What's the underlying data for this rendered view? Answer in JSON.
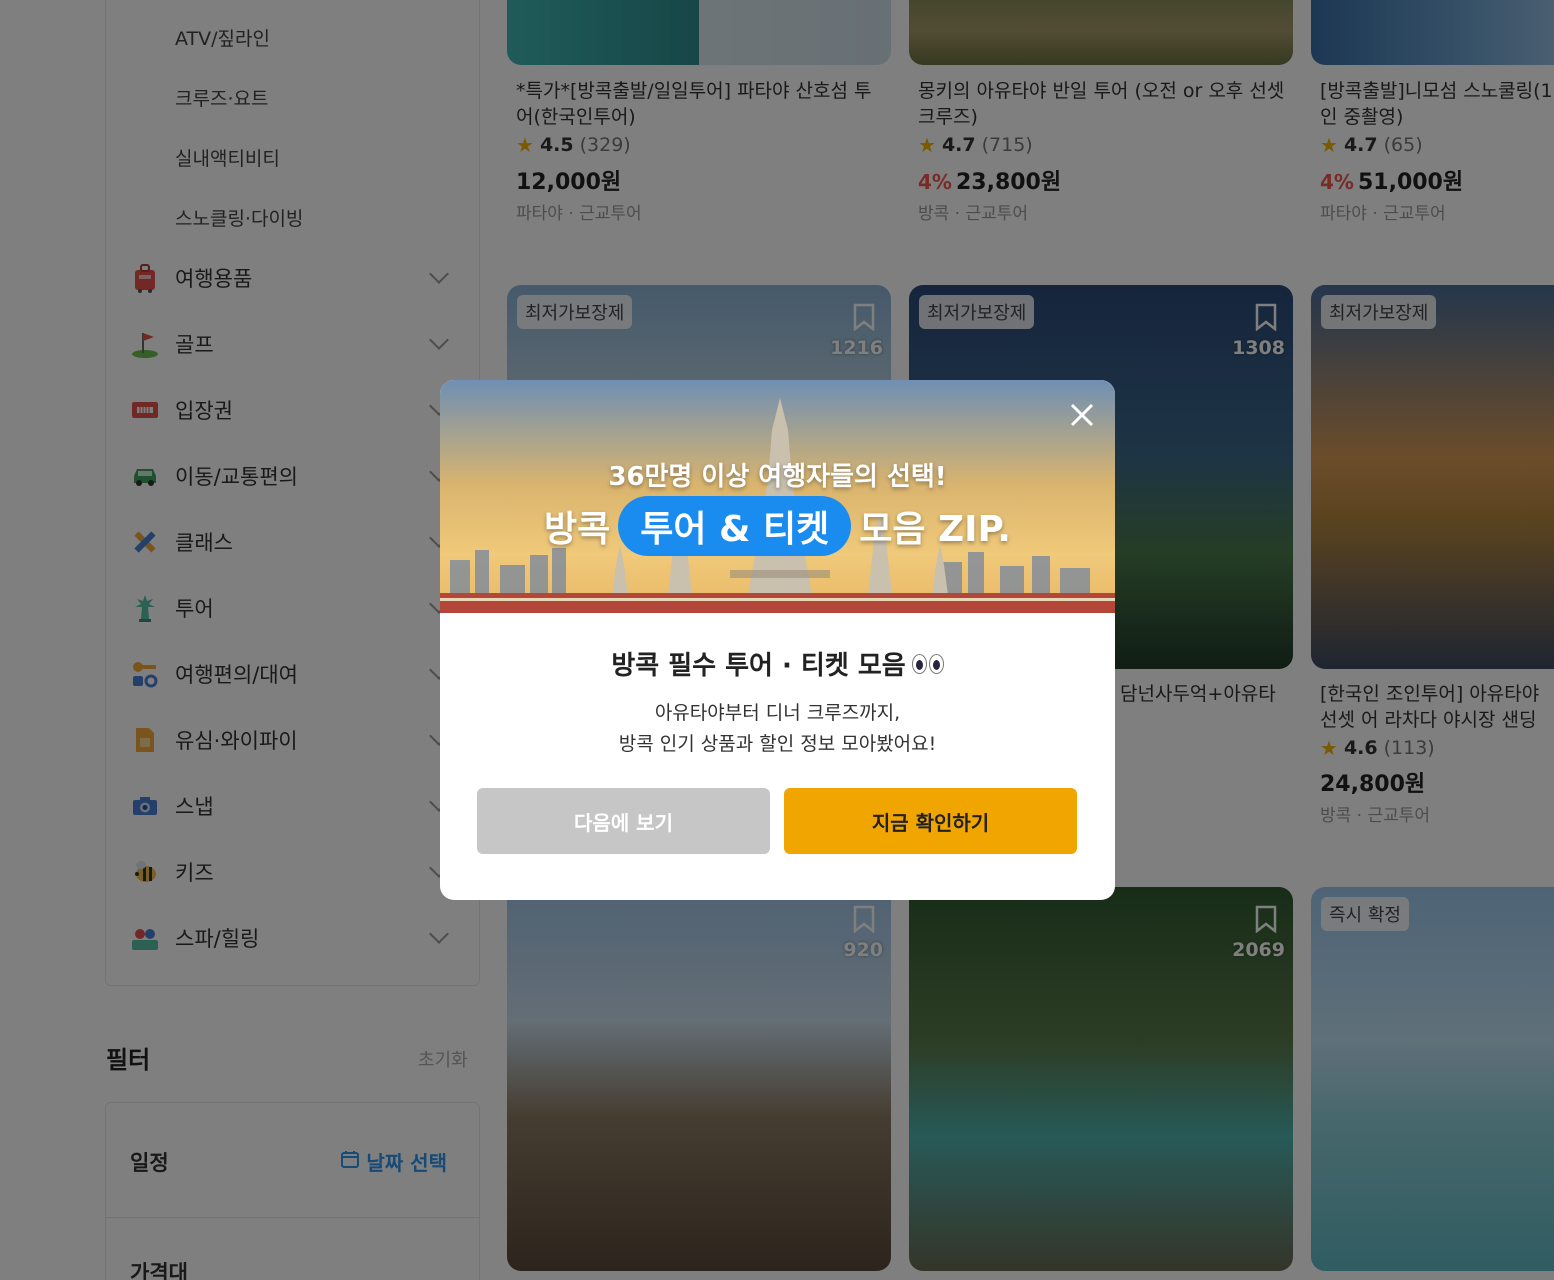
{
  "sidebar": {
    "sub_items": [
      "ATV/짚라인",
      "크루즈·요트",
      "실내액티비티",
      "스노클링·다이빙"
    ],
    "categories": [
      {
        "label": "여행용품",
        "icon": "luggage-icon"
      },
      {
        "label": "골프",
        "icon": "golf-flag-icon"
      },
      {
        "label": "입장권",
        "icon": "ticket-icon"
      },
      {
        "label": "이동/교통편의",
        "icon": "car-icon"
      },
      {
        "label": "클래스",
        "icon": "pencil-ruler-icon"
      },
      {
        "label": "투어",
        "icon": "statue-of-liberty-icon"
      },
      {
        "label": "여행편의/대여",
        "icon": "key-gear-icon"
      },
      {
        "label": "유심·와이파이",
        "icon": "sim-card-icon"
      },
      {
        "label": "스냅",
        "icon": "camera-icon"
      },
      {
        "label": "키즈",
        "icon": "bee-icon"
      },
      {
        "label": "스파/힐링",
        "icon": "spa-icon"
      }
    ],
    "filter": {
      "title": "필터",
      "reset": "초기화",
      "schedule": "일정",
      "date_select": "날짜 선택",
      "price": "가격대"
    }
  },
  "products": {
    "row1": [
      {
        "title": "*특가*[방콕출발/일일투어] 파타야 산호섬 투어(한국인투어)",
        "rating": "4.5",
        "count": "(329)",
        "discount": "",
        "price": "12,000원",
        "location": "파타야 · 근교투어"
      },
      {
        "title": "몽키의 아유타야 반일 투어 (오전 or 오후 선셋 크루즈)",
        "rating": "4.7",
        "count": "(715)",
        "discount": "4%",
        "price": "23,800원",
        "location": "방콕 · 근교투어"
      },
      {
        "title": "[방콕출발]니모섬 스노쿨링(1인 중촬영)",
        "rating": "4.7",
        "count": "(65)",
        "discount": "4%",
        "price": "51,000원",
        "location": "파타야 · 근교투어"
      }
    ],
    "row2": [
      {
        "badge": "최저가보장제",
        "bookmarks": "1216"
      },
      {
        "badge": "최저가보장제",
        "bookmarks": "1308",
        "title_partial": "담넌사두억+아유타"
      },
      {
        "badge": "최저가보장제",
        "title": "[한국인 조인투어] 아유타야 선셋 어 라차다 야시장 샌딩",
        "rating": "4.6",
        "count": "(113)",
        "price": "24,800원",
        "location": "방콕 · 근교투어"
      }
    ],
    "row3": [
      {
        "bookmarks": "920"
      },
      {
        "bookmarks": "2069"
      },
      {
        "badge": "즉시 확정"
      }
    ]
  },
  "modal": {
    "banner_line1": "36만명 이상 여행자들의 선택!",
    "banner_pre": "방콕",
    "banner_pill": "투어 & 티켓",
    "banner_post": "모음 ZIP.",
    "title": "방콕 필수 투어 · 티켓 모음",
    "desc_line1": "아유타야부터 디너 크루즈까지,",
    "desc_line2": "방콕 인기 상품과 할인 정보 모아봤어요!",
    "btn_later": "다음에 보기",
    "btn_now": "지금 확인하기"
  },
  "colors": {
    "accent_blue": "#1a8cf0",
    "cta_yellow": "#f0a500",
    "discount_red": "#f0564e",
    "star": "#f4b400"
  }
}
